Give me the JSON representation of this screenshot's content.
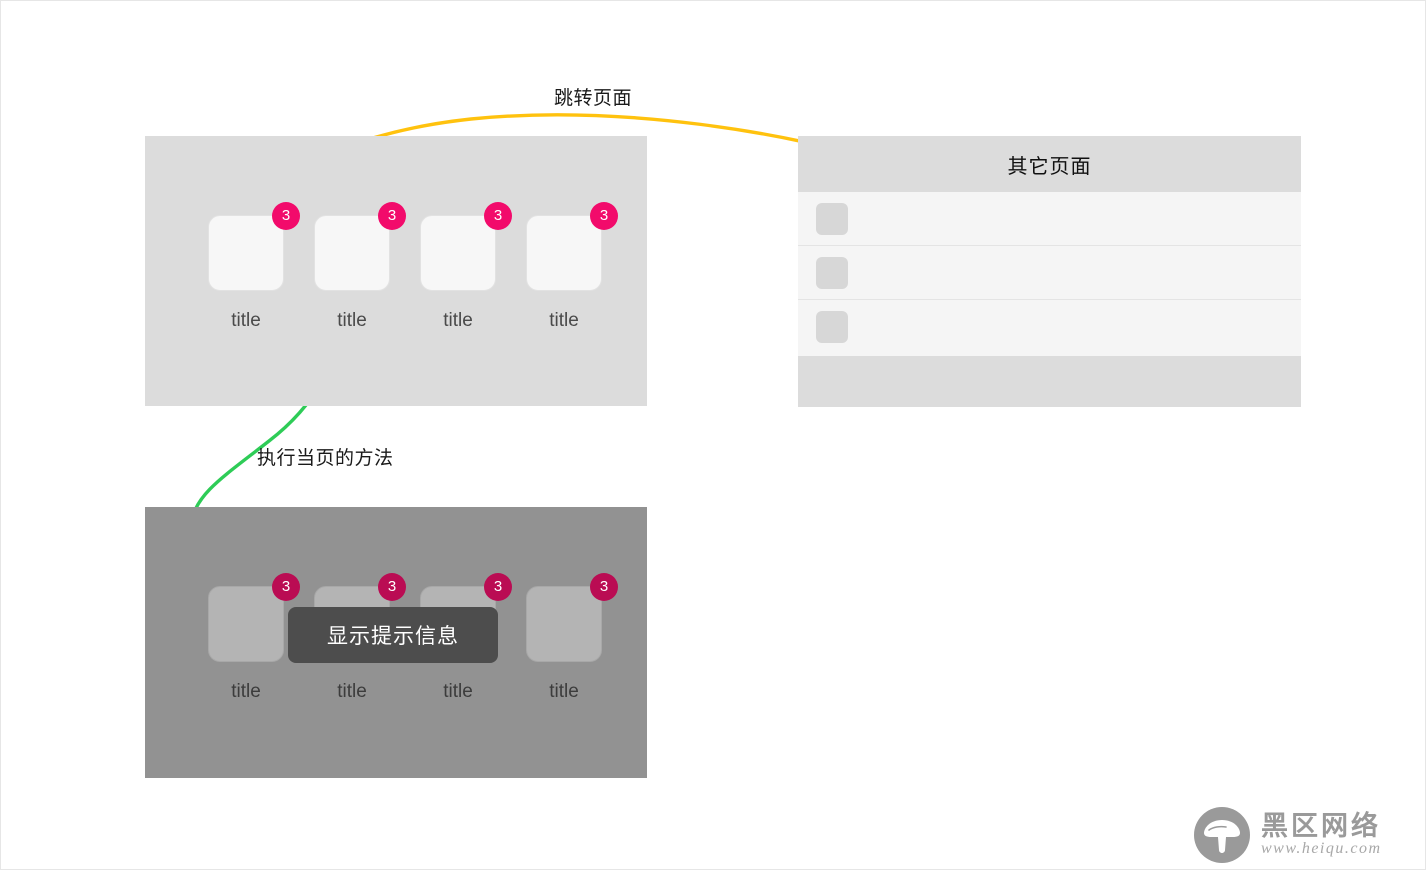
{
  "annotations": {
    "jump_label": "跳转页面",
    "exec_label": "执行当页的方法",
    "curve_jump_color": "#FFC20E",
    "curve_exec_color": "#2ECC57"
  },
  "home_panel": {
    "background": "#dcdcdc",
    "tiles": [
      {
        "label": "title",
        "badge": "3"
      },
      {
        "label": "title",
        "badge": "3"
      },
      {
        "label": "title",
        "badge": "3"
      },
      {
        "label": "title",
        "badge": "3"
      }
    ]
  },
  "dim_panel": {
    "background": "#929292",
    "tooltip_text": "显示提示信息",
    "tiles": [
      {
        "label": "title",
        "badge": "3"
      },
      {
        "label": "title",
        "badge": "3"
      },
      {
        "label": "title",
        "badge": "3"
      },
      {
        "label": "title",
        "badge": "3"
      }
    ]
  },
  "other_panel": {
    "title": "其它页面",
    "rows": [
      {
        "thumb": "thumbnail-placeholder"
      },
      {
        "thumb": "thumbnail-placeholder"
      },
      {
        "thumb": "thumbnail-placeholder"
      }
    ]
  },
  "watermark": {
    "name": "黑区网络",
    "url": "www.heiqu.com",
    "color": "#9a9a9a"
  },
  "theme": {
    "badge_color": "#f20b6b",
    "badge_color_dim": "#ba0c53",
    "tooltip_bg": "#4d4d4d"
  }
}
